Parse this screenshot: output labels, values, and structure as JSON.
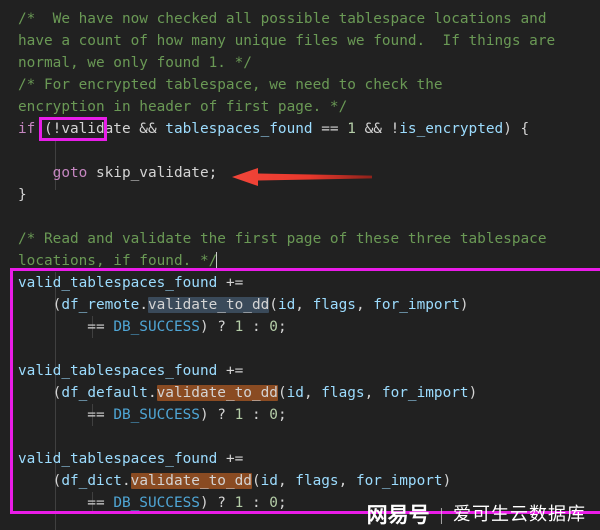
{
  "editor": {
    "background": "#212121",
    "language": "C++",
    "lines": [
      {
        "indent": 0,
        "tokens": [
          {
            "t": "cmt",
            "s": "/*  We have now checked all possible tablespace locations and"
          }
        ]
      },
      {
        "indent": 0,
        "tokens": [
          {
            "t": "cmt",
            "s": "have a count of how many unique files we found.  If things are"
          }
        ]
      },
      {
        "indent": 0,
        "tokens": [
          {
            "t": "cmt",
            "s": "normal, we only found 1. */"
          }
        ]
      },
      {
        "indent": 0,
        "tokens": [
          {
            "t": "cmt",
            "s": "/* For encrypted tablespace, we need to check the"
          }
        ]
      },
      {
        "indent": 0,
        "tokens": [
          {
            "t": "cmt",
            "s": "encryption in header of first page. */"
          }
        ]
      },
      {
        "indent": 0,
        "tokens": [
          {
            "t": "kw",
            "s": "if"
          },
          {
            "t": "plain",
            "s": " ("
          },
          {
            "t": "id",
            "s": "!validate"
          },
          {
            "t": "plain",
            "s": " && "
          },
          {
            "t": "var",
            "s": "tablespaces_found"
          },
          {
            "t": "plain",
            "s": " == "
          },
          {
            "t": "num",
            "s": "1"
          },
          {
            "t": "plain",
            "s": " && !"
          },
          {
            "t": "var",
            "s": "is_encrypted"
          },
          {
            "t": "plain",
            "s": ") {"
          }
        ]
      },
      {
        "indent": 0,
        "tokens": []
      },
      {
        "indent": 0,
        "tokens": [
          {
            "t": "plain",
            "s": "    "
          },
          {
            "t": "kw",
            "s": "goto"
          },
          {
            "t": "plain",
            "s": " "
          },
          {
            "t": "id",
            "s": "skip_validate"
          },
          {
            "t": "plain",
            "s": ";"
          }
        ]
      },
      {
        "indent": 0,
        "tokens": [
          {
            "t": "plain",
            "s": "}"
          }
        ]
      },
      {
        "indent": 0,
        "tokens": []
      },
      {
        "indent": 0,
        "tokens": [
          {
            "t": "cmt",
            "s": "/* Read and validate the first page of these three tablespace"
          }
        ]
      },
      {
        "indent": 0,
        "tokens": [
          {
            "t": "cmt",
            "s": "locations, if found. */"
          },
          {
            "t": "caret",
            "s": ""
          }
        ]
      },
      {
        "indent": 0,
        "tokens": [
          {
            "t": "var",
            "s": "valid_tablespaces_found"
          },
          {
            "t": "plain",
            "s": " +="
          }
        ]
      },
      {
        "indent": 0,
        "tokens": [
          {
            "t": "plain",
            "s": "    ("
          },
          {
            "t": "var",
            "s": "df_remote"
          },
          {
            "t": "plain",
            "s": "."
          },
          {
            "t": "sel-blue",
            "s": "validate_to_dd"
          },
          {
            "t": "plain",
            "s": "("
          },
          {
            "t": "var",
            "s": "id"
          },
          {
            "t": "plain",
            "s": ", "
          },
          {
            "t": "var",
            "s": "flags"
          },
          {
            "t": "plain",
            "s": ", "
          },
          {
            "t": "var",
            "s": "for_import"
          },
          {
            "t": "plain",
            "s": ")"
          }
        ]
      },
      {
        "indent": 0,
        "tokens": [
          {
            "t": "plain",
            "s": "        == "
          },
          {
            "t": "const",
            "s": "DB_SUCCESS"
          },
          {
            "t": "plain",
            "s": ") ? "
          },
          {
            "t": "num",
            "s": "1"
          },
          {
            "t": "plain",
            "s": " : "
          },
          {
            "t": "num",
            "s": "0"
          },
          {
            "t": "plain",
            "s": ";"
          }
        ]
      },
      {
        "indent": 0,
        "tokens": []
      },
      {
        "indent": 0,
        "tokens": [
          {
            "t": "var",
            "s": "valid_tablespaces_found"
          },
          {
            "t": "plain",
            "s": " +="
          }
        ]
      },
      {
        "indent": 0,
        "tokens": [
          {
            "t": "plain",
            "s": "    ("
          },
          {
            "t": "var",
            "s": "df_default"
          },
          {
            "t": "plain",
            "s": "."
          },
          {
            "t": "sel-orange",
            "s": "validate_to_dd"
          },
          {
            "t": "plain",
            "s": "("
          },
          {
            "t": "var",
            "s": "id"
          },
          {
            "t": "plain",
            "s": ", "
          },
          {
            "t": "var",
            "s": "flags"
          },
          {
            "t": "plain",
            "s": ", "
          },
          {
            "t": "var",
            "s": "for_import"
          },
          {
            "t": "plain",
            "s": ")"
          }
        ]
      },
      {
        "indent": 0,
        "tokens": [
          {
            "t": "plain",
            "s": "        == "
          },
          {
            "t": "const",
            "s": "DB_SUCCESS"
          },
          {
            "t": "plain",
            "s": ") ? "
          },
          {
            "t": "num",
            "s": "1"
          },
          {
            "t": "plain",
            "s": " : "
          },
          {
            "t": "num",
            "s": "0"
          },
          {
            "t": "plain",
            "s": ";"
          }
        ]
      },
      {
        "indent": 0,
        "tokens": []
      },
      {
        "indent": 0,
        "tokens": [
          {
            "t": "var",
            "s": "valid_tablespaces_found"
          },
          {
            "t": "plain",
            "s": " +="
          }
        ]
      },
      {
        "indent": 0,
        "tokens": [
          {
            "t": "plain",
            "s": "    ("
          },
          {
            "t": "var",
            "s": "df_dict"
          },
          {
            "t": "plain",
            "s": "."
          },
          {
            "t": "sel-orange",
            "s": "validate_to_dd"
          },
          {
            "t": "plain",
            "s": "("
          },
          {
            "t": "var",
            "s": "id"
          },
          {
            "t": "plain",
            "s": ", "
          },
          {
            "t": "var",
            "s": "flags"
          },
          {
            "t": "plain",
            "s": ", "
          },
          {
            "t": "var",
            "s": "for_import"
          },
          {
            "t": "plain",
            "s": ")"
          }
        ]
      },
      {
        "indent": 0,
        "tokens": [
          {
            "t": "plain",
            "s": "        == "
          },
          {
            "t": "const",
            "s": "DB_SUCCESS"
          },
          {
            "t": "plain",
            "s": ") ? "
          },
          {
            "t": "num",
            "s": "1"
          },
          {
            "t": "plain",
            "s": " : "
          },
          {
            "t": "num",
            "s": "0"
          },
          {
            "t": "plain",
            "s": ";"
          }
        ]
      }
    ]
  },
  "annotations": {
    "color": "#e81ee8",
    "arrow_color": "#e8382c",
    "boxes": [
      {
        "id": "box-validate",
        "target": "!validate"
      },
      {
        "id": "box-block",
        "target": "valid_tablespaces_found accumulation block"
      }
    ],
    "arrow": {
      "points_to": "goto skip_validate;",
      "direction": "left"
    }
  },
  "watermark": {
    "logo": "网易号",
    "separator": "|",
    "text": "爱可生云数据库"
  }
}
